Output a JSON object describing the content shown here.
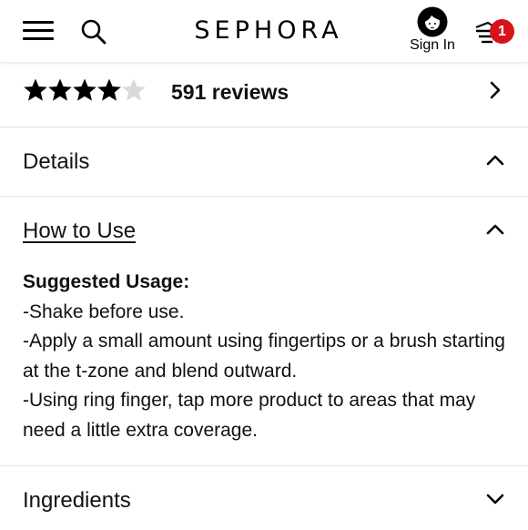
{
  "header": {
    "logo": "SEPHORA",
    "sign_in_label": "Sign In",
    "basket_count": "1",
    "icons": [
      "menu-icon",
      "search-icon",
      "user-avatar-icon",
      "basket-icon"
    ],
    "badge_color": "#d6131b"
  },
  "reviews": {
    "rating": 4,
    "rating_max": 5,
    "count_label": "591 reviews",
    "star_filled_color": "#000000",
    "star_empty_color": "#d9d9d9"
  },
  "sections": {
    "details": {
      "title": "Details",
      "expanded": true
    },
    "how_to_use": {
      "title": "How to Use",
      "expanded": true,
      "heading": "Suggested Usage:",
      "lines": [
        "-Shake before use.",
        "-Apply a small amount using fingertips or a brush starting at the t-zone and blend outward.",
        "-Using ring finger, tap more product to areas that may need a little extra coverage."
      ]
    },
    "ingredients": {
      "title": "Ingredients",
      "expanded": false
    }
  }
}
